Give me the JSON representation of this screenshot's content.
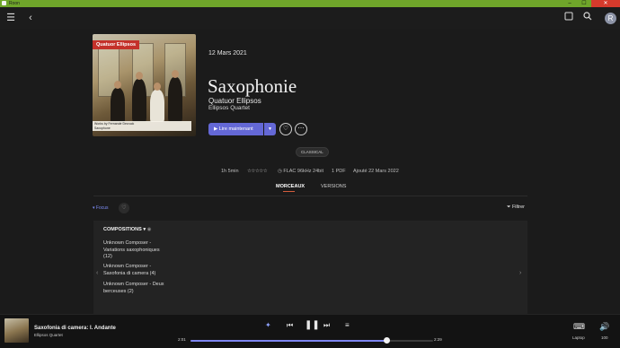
{
  "window": {
    "title": "Roon",
    "minimize": "–",
    "maximize": "☐",
    "close": "✕"
  },
  "appbar": {
    "menu_icon": "menu-icon",
    "back_icon": "back-arrow-icon",
    "search_icon": "search-icon",
    "avatar_letter": "R"
  },
  "album": {
    "cover_tag": "Quatuor Ellipsos",
    "cover_caption_1": "Works by Fernande Decruck",
    "cover_caption_2": "Saxophone",
    "date": "12 Mars 2021",
    "title": "Saxophonie",
    "artist": "Quatuor Ellipsos",
    "artist_secondary": "Ellipsos Quartet",
    "play_label": "Lire maintenant",
    "genre": "CLASSICAL"
  },
  "meta": {
    "duration": "1h 5min",
    "rating": "☆☆☆☆☆",
    "format": "FLAC 96kHz 24bit",
    "pdf": "1 PDF",
    "added": "Ajouté 22 Mars 2022"
  },
  "tabs": [
    {
      "label": "MORCEAUX",
      "active": true
    },
    {
      "label": "VERSIONS",
      "active": false
    }
  ],
  "toolbar": {
    "focus_label": "Focus",
    "filter_label": "Filtrer"
  },
  "compositions": {
    "header": "COMPOSITIONS",
    "items": [
      {
        "line1": "Unknown Composer -",
        "line2": "Variations saxophoniques",
        "line3": "(12)"
      },
      {
        "line1": "Unknown Composer -",
        "line2": "Saxofonia di camera (4)",
        "line3": ""
      },
      {
        "line1": "Unknown Composer - Deux",
        "line2": "berceuses (2)",
        "line3": ""
      }
    ]
  },
  "player": {
    "track_title": "Saxofonia di camera: I. Andante",
    "track_artist": "Ellipsos Quartet",
    "elapsed": "2:01",
    "total": "2:29",
    "progress": 0.81,
    "zone_name": "Laptop",
    "volume": "100"
  },
  "colors": {
    "accent": "#6468d6",
    "titlebar": "#6fa52a",
    "tab_underline": "#d35c3c"
  }
}
